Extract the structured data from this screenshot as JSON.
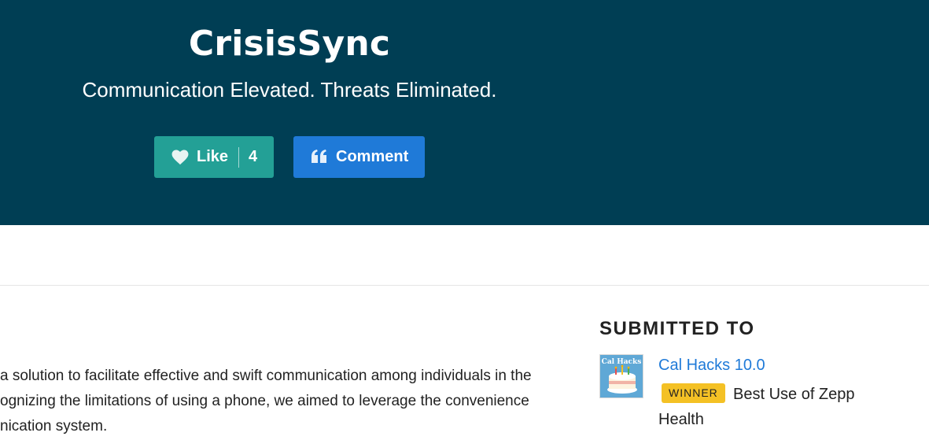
{
  "hero": {
    "title": "CrisisSync",
    "tagline": "Communication Elevated. Threats Eliminated.",
    "like_label": "Like",
    "like_count": "4",
    "comment_label": "Comment"
  },
  "description": {
    "lines": [
      "a solution to facilitate effective and swift communication among individuals in the",
      "ognizing the limitations of using a phone, we aimed to leverage the convenience",
      "nication system."
    ]
  },
  "sidebar": {
    "heading": "SUBMITTED TO",
    "hackathon_name": "Cal Hacks 10.0",
    "thumbnail_text": "Cal Hacks",
    "badge": "WINNER",
    "prize": "Best Use of Zepp Health"
  },
  "colors": {
    "hero_bg": "#003e54",
    "like_bg": "#23a096",
    "comment_bg": "#1f7ad8",
    "winner_bg": "#f4c125",
    "link": "#1f7ad8"
  },
  "icons": {
    "like": "heart-icon",
    "comment": "quote-icon"
  }
}
